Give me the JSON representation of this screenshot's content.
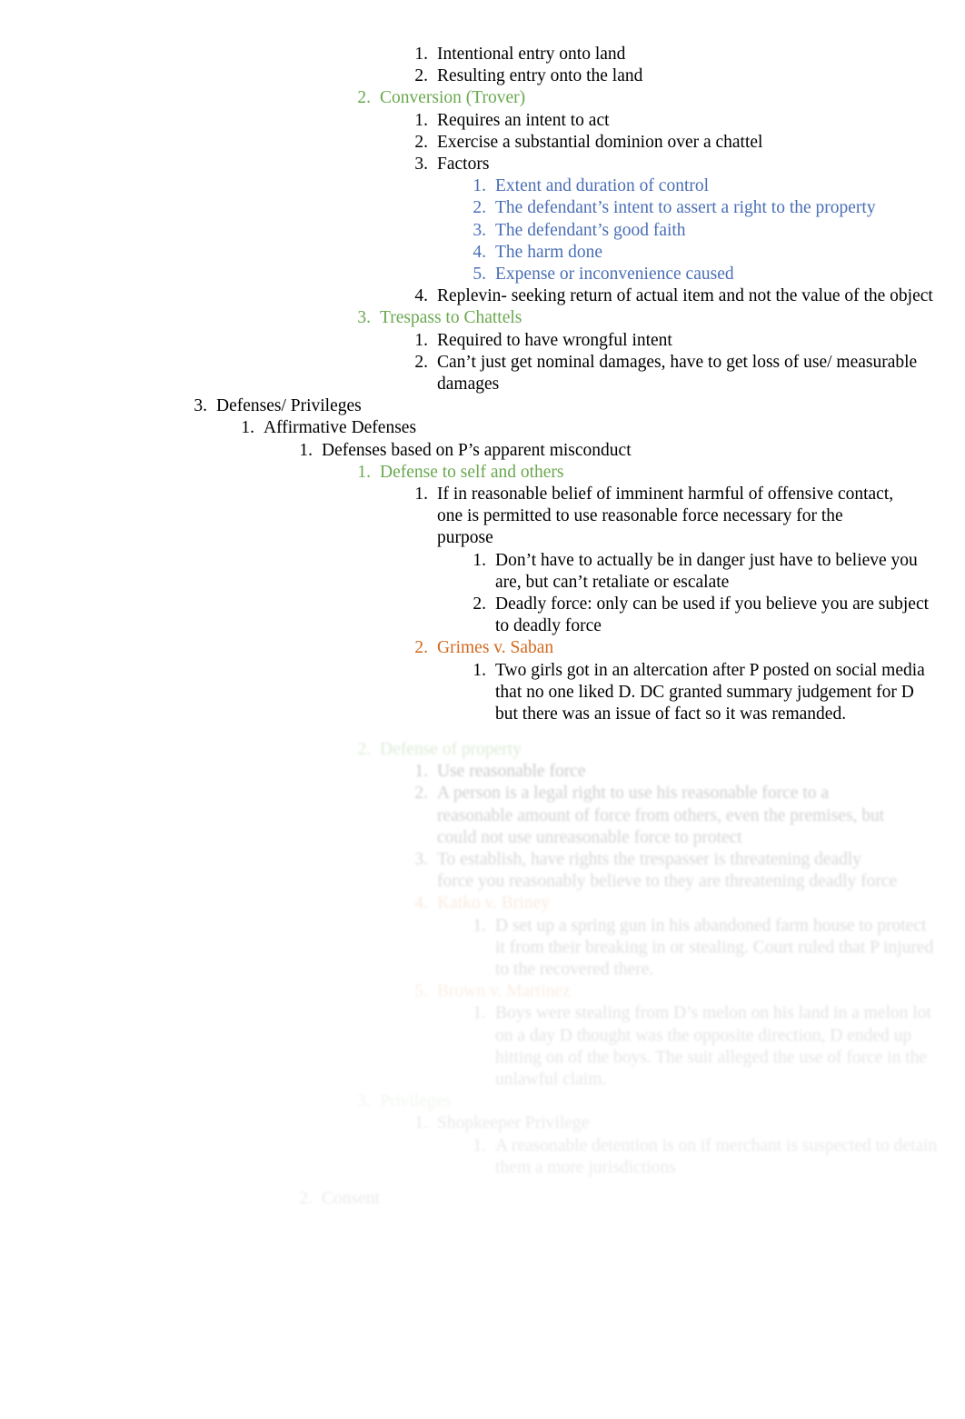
{
  "document": {
    "type": "legal-outline-notes",
    "colors": {
      "green": "#6aa84f",
      "blue": "#4a6fb5",
      "orange": "#d2691e",
      "black": "#000000",
      "background": "#ffffff"
    }
  },
  "outline": {
    "visible": [
      {
        "marker": "1.",
        "text": "Intentional entry onto land",
        "color": "black",
        "level": 4
      },
      {
        "marker": "2.",
        "text": "Resulting entry onto the land",
        "color": "black",
        "level": 4
      },
      {
        "marker": "2.",
        "text": "Conversion (Trover)",
        "color": "green",
        "level": 3
      },
      {
        "marker": "1.",
        "text": "Requires an intent to act",
        "color": "black",
        "level": 4
      },
      {
        "marker": "2.",
        "text": "Exercise a substantial dominion over a chattel",
        "color": "black",
        "level": 4
      },
      {
        "marker": "3.",
        "text": "Factors",
        "color": "black",
        "level": 4
      },
      {
        "marker": "1.",
        "text": "Extent and duration of control",
        "color": "blue",
        "level": 5
      },
      {
        "marker": "2.",
        "text": "The defendant’s intent to assert a right to the property",
        "color": "blue",
        "level": 5
      },
      {
        "marker": "3.",
        "text": "The defendant’s good faith",
        "color": "blue",
        "level": 5
      },
      {
        "marker": "4.",
        "text": "The harm done",
        "color": "blue",
        "level": 5
      },
      {
        "marker": "5.",
        "text": "Expense or inconvenience caused",
        "color": "blue",
        "level": 5
      },
      {
        "marker": "4.",
        "text": "Replevin- seeking return of actual item and not the value of the object",
        "color": "black",
        "level": 4
      },
      {
        "marker": "3.",
        "text": "Trespass to Chattels",
        "color": "green",
        "level": 3
      },
      {
        "marker": "1.",
        "text": "Required to have wrongful intent",
        "color": "black",
        "level": 4
      },
      {
        "marker": "2.",
        "text": "Can’t just get nominal damages, have to get loss of use/ measurable damages",
        "color": "black",
        "level": 4
      },
      {
        "marker": "3.",
        "text": "Defenses/ Privileges",
        "color": "black",
        "level": 1
      },
      {
        "marker": "1.",
        "text": "Affirmative Defenses",
        "color": "black",
        "level": 2
      },
      {
        "marker": "1.",
        "text": "Defenses based on P’s apparent misconduct",
        "color": "black",
        "level": 3
      },
      {
        "marker": "1.",
        "text": "Defense to self and others",
        "color": "green",
        "level": 4
      },
      {
        "marker": "1.",
        "text": "If in reasonable belief of imminent harmful of offensive contact, one is permitted to use reasonable force necessary for the purpose",
        "color": "black",
        "level": 5
      },
      {
        "marker": "1.",
        "text": "Don’t have to actually be in danger just have to believe you are, but can’t retaliate or escalate",
        "color": "black",
        "level": 6
      },
      {
        "marker": "2.",
        "text": "Deadly force: only can be used if you believe you are subject to deadly force",
        "color": "black",
        "level": 6
      },
      {
        "marker": "2.",
        "text": "Grimes v. Saban",
        "color": "orange",
        "level": 5
      },
      {
        "marker": "1.",
        "text": "Two girls got in an altercation after P posted on social media that no one liked D. DC granted summary judgement for D but there was an issue of fact so it was remanded.",
        "color": "black",
        "level": 6
      }
    ],
    "faded": [
      {
        "marker": "2.",
        "text": "Defense of property",
        "color": "green",
        "level": 4
      },
      {
        "marker": "1.",
        "text": "Use reasonable force",
        "color": "black",
        "level": 5
      },
      {
        "marker": "2.",
        "text": "A person is a legal right to use his reasonable force to a reasonable amount of force from others, even the premises, but could not use unreasonable force to protect",
        "color": "black",
        "level": 5
      },
      {
        "marker": "3.",
        "text": "To establish, have rights the trespasser is threatening deadly force you reasonably believe to they are threatening deadly force",
        "color": "black",
        "level": 5
      },
      {
        "marker": "4.",
        "text": "Katko v. Briney",
        "color": "orange",
        "level": 5
      },
      {
        "marker": "1.",
        "text": "D set up a spring gun in his abandoned farm house to protect it from their breaking in or stealing. Court ruled that P injured to the recovered there.",
        "color": "black",
        "level": 6
      },
      {
        "marker": "5.",
        "text": "Brown v. Martinez",
        "color": "orange",
        "level": 5
      },
      {
        "marker": "1.",
        "text": "Boys were stealing from D’s melon on his land in a melon lot on a day D thought was the opposite direction, D ended up hitting on of the boys. The suit alleged the use of force in the unlawful claim.",
        "color": "black",
        "level": 6
      },
      {
        "marker": "3.",
        "text": "Privileges",
        "color": "green",
        "level": 4
      },
      {
        "marker": "1.",
        "text": "Shopkeeper Privilege",
        "color": "black",
        "level": 5
      },
      {
        "marker": "1.",
        "text": "A reasonable detention is on if merchant is suspected to detain them a more jurisdictions",
        "color": "black",
        "level": 6
      },
      {
        "marker": "2.",
        "text": "Consent",
        "color": "black",
        "level": 3
      }
    ]
  }
}
